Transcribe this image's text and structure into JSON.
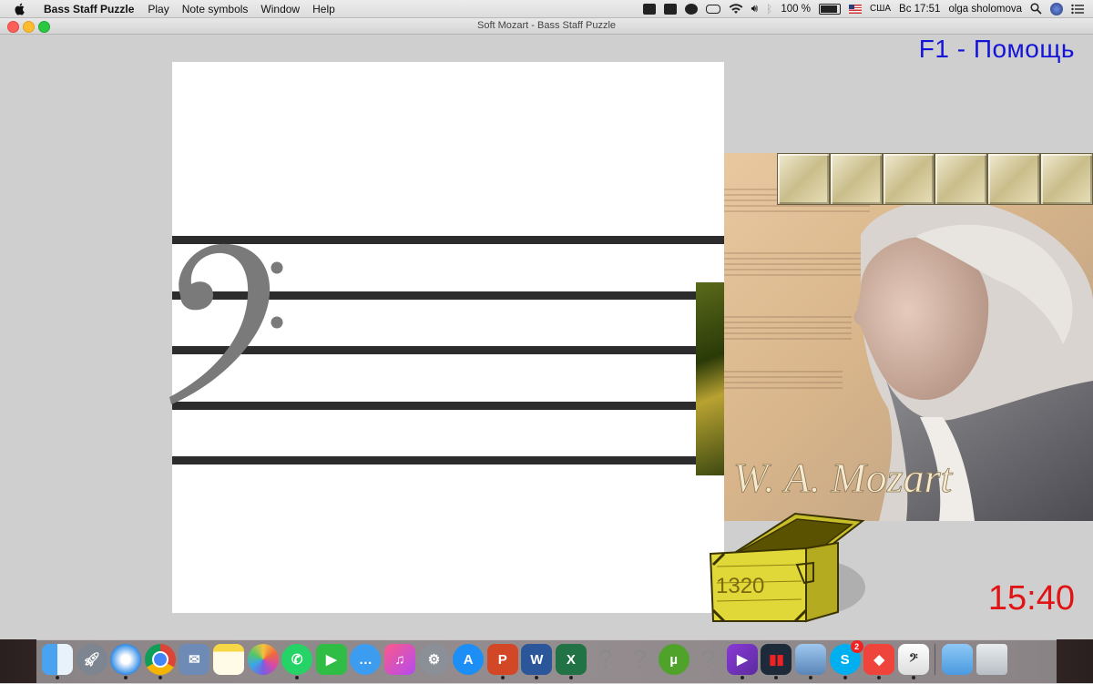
{
  "menubar": {
    "app_name": "Bass Staff Puzzle",
    "menus": [
      "Play",
      "Note symbols",
      "Window",
      "Help"
    ],
    "battery_text": "100 %",
    "input_source": "США",
    "clock_text": "Вс 17:51",
    "user_name": "olga sholomova"
  },
  "window": {
    "title": "Soft Mozart - Bass Staff Puzzle"
  },
  "game": {
    "help_text": "F1 - Помощь",
    "timer_text": "15:40",
    "chest_count": "1320",
    "portrait_caption": "W. A. Mozart",
    "colors": {
      "help": "#1414d8",
      "timer": "#e01414"
    }
  },
  "dock": {
    "icons": [
      "finder-icon",
      "launchpad-icon",
      "safari-icon",
      "chrome-icon",
      "mail-icon",
      "notes-icon",
      "photos-icon",
      "whatsapp-icon",
      "facetime-icon",
      "messages-icon",
      "itunes-icon",
      "system-preferences-icon",
      "app-store-icon",
      "powerpoint-icon",
      "word-icon",
      "excel-icon",
      "unknown-app-icon",
      "unknown-app-icon",
      "utorrent-icon",
      "unknown-app-icon",
      "visual-studio-icon",
      "activity-monitor-icon",
      "preview-icon",
      "skype-icon",
      "anydesk-icon",
      "soft-mozart-icon",
      "downloads-folder-icon",
      "trash-icon"
    ],
    "skype_badge": "2"
  }
}
